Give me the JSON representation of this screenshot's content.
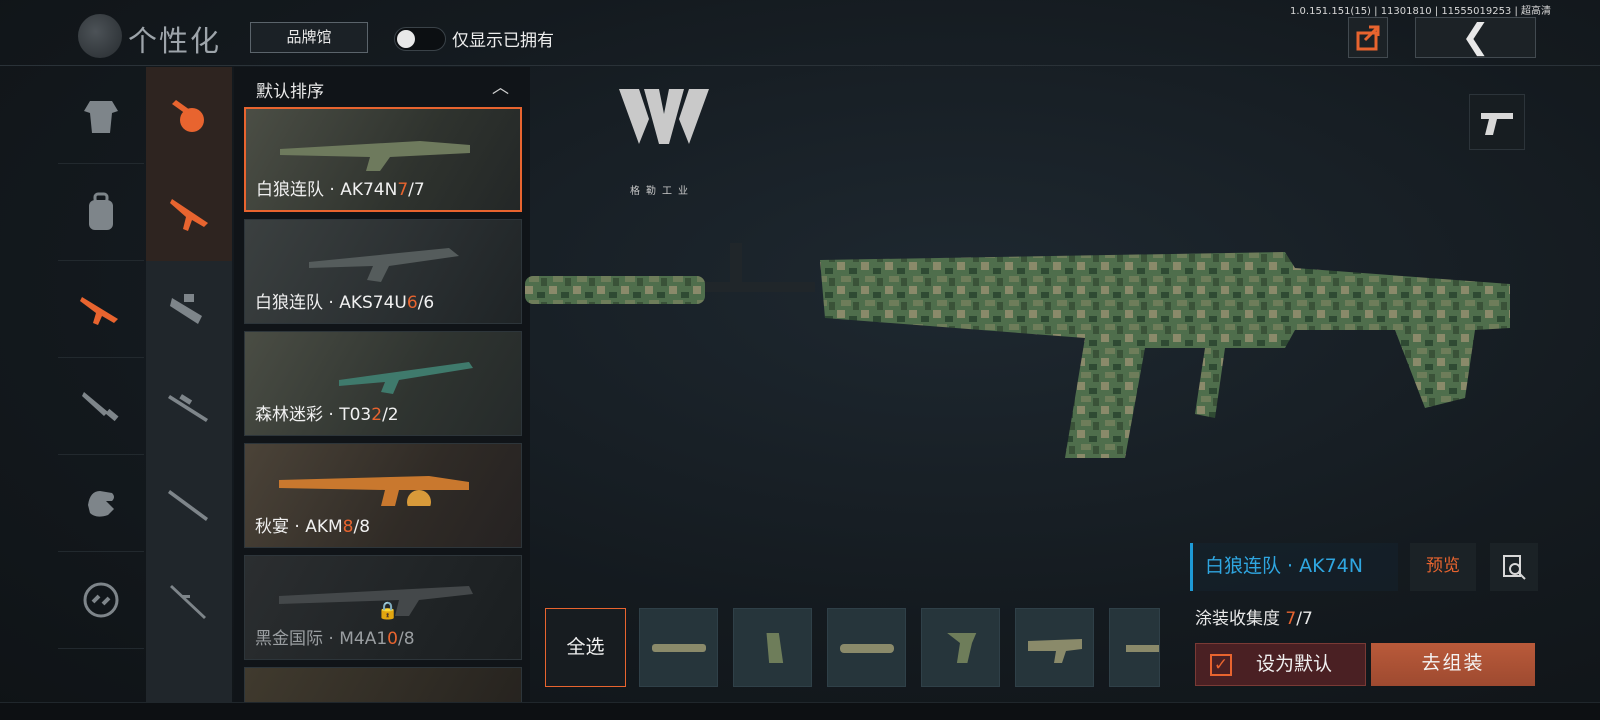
{
  "header": {
    "title": "个性化",
    "brand_hall_label": "品牌馆",
    "owned_only_label": "仅显示已拥有",
    "owned_only_enabled": false,
    "version": "1.0.151.151(15) | 11301810 | 11555019253 | 超高清",
    "share_icon": "share-icon",
    "back_icon": "back-chevron-icon"
  },
  "categories_left": [
    "outfit-icon",
    "backpack-icon",
    "rifle-icon",
    "knife-icon",
    "gloves-icon",
    "link-icon"
  ],
  "categories_right": [
    "grenade-icon",
    "assault-rifle-icon",
    "smg-icon",
    "sniper-icon",
    "marksman-rifle-icon",
    "bolt-rifle-icon"
  ],
  "list": {
    "sort_label": "默认排序",
    "items": [
      {
        "name": "白狼连队 · AK74N",
        "owned": "7",
        "total": "/7",
        "selected": true,
        "locked": false
      },
      {
        "name": "白狼连队 · AKS74U",
        "owned": "6",
        "total": "/6",
        "selected": false,
        "locked": false
      },
      {
        "name": "森林迷彩 · T03",
        "owned": "2",
        "total": "/2",
        "selected": false,
        "locked": false
      },
      {
        "name": "秋宴 · AKM",
        "owned": "8",
        "total": "/8",
        "selected": false,
        "locked": false
      },
      {
        "name": "黑金国际 · M4A1",
        "owned": "0",
        "total": "/8",
        "selected": false,
        "locked": true
      }
    ]
  },
  "stage": {
    "brand_name": "格勒工业",
    "weapon_title": "白狼连队 · AK74N",
    "preview_label": "预览",
    "collection_label": "涂装收集度",
    "collection_owned": "7",
    "collection_total": "/7",
    "select_all_label": "全选",
    "parts": [
      "suppressor",
      "magazine",
      "handguard",
      "grip",
      "stock",
      "barrel"
    ],
    "set_default_label": "设为默认",
    "set_default_checked": true,
    "assemble_label": "去组装"
  },
  "colors": {
    "accent": "#e8642f",
    "name_blue": "#2fa6e0",
    "background": "#15191d"
  }
}
